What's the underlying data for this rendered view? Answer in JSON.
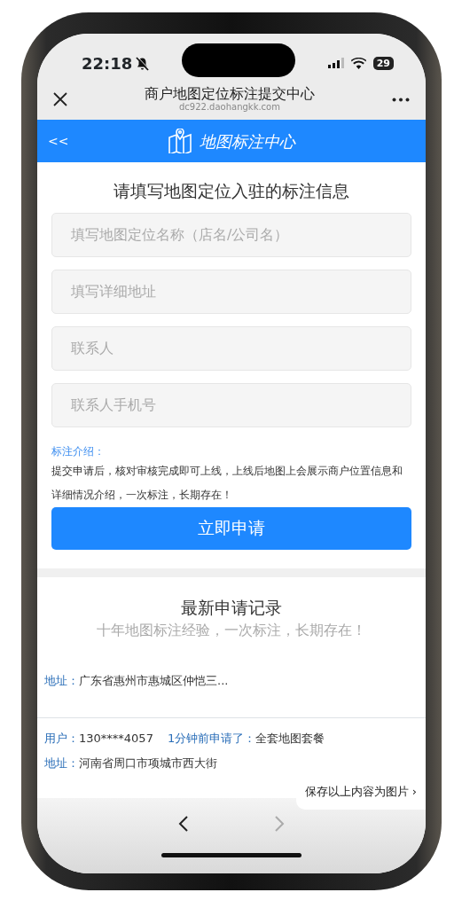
{
  "status_bar": {
    "time": "22:18",
    "battery": "29"
  },
  "browser": {
    "title": "商户地图定位标注提交中心",
    "url": "dc922.daohangkk.com"
  },
  "header": {
    "back": "<<",
    "logo_text": "地图标注中心"
  },
  "form": {
    "heading": "请填写地图定位入驻的标注信息",
    "fields": [
      {
        "placeholder": "填写地图定位名称（店名/公司名）"
      },
      {
        "placeholder": "填写详细地址"
      },
      {
        "placeholder": "联系人"
      },
      {
        "placeholder": "联系人手机号"
      }
    ],
    "intro_label": "标注介绍：",
    "intro_text": "提交申请后，核对审核完成即可上线，上线后地图上会展示商户位置信息和详细情况介绍，一次标注，长期存在！",
    "submit": "立即申请"
  },
  "records": {
    "title": "最新申请记录",
    "subtitle": "十年地图标注经验，一次标注，长期存在！",
    "items": [
      {
        "address_label": "地址：",
        "address": "广东省惠州市惠城区仲恺三..."
      },
      {
        "user_label": "用户：",
        "user": "130****4057",
        "time_label": "1分钟前申请了：",
        "plan": "全套地图套餐",
        "address_label": "地址：",
        "address": "河南省周口市项城市西大街"
      }
    ]
  },
  "toolbar": {
    "back_enabled": true,
    "forward_enabled": false
  },
  "save_popup": {
    "label": "保存以上内容为图片",
    "chevron": "›"
  }
}
